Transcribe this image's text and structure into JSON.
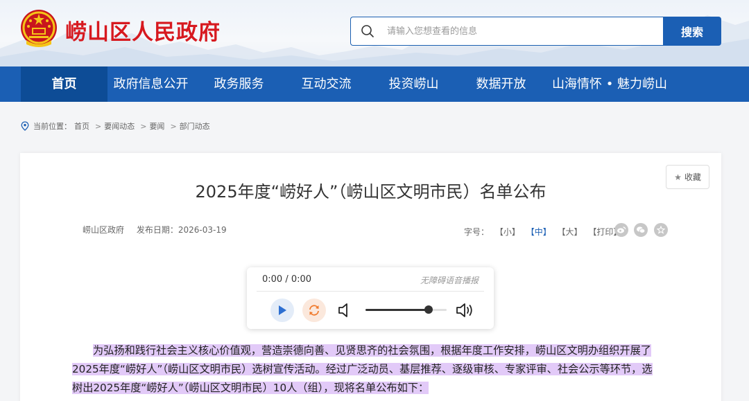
{
  "header": {
    "site_title": "崂山区人民政府",
    "search_placeholder": "请输入您想查看的信息",
    "search_button": "搜索"
  },
  "nav": {
    "items": [
      {
        "label": "首页",
        "active": true
      },
      {
        "label": "政府信息公开",
        "active": false
      },
      {
        "label": "政务服务",
        "active": false
      },
      {
        "label": "互动交流",
        "active": false
      },
      {
        "label": "投资崂山",
        "active": false
      },
      {
        "label": "数据开放",
        "active": false
      },
      {
        "label": "山海情怀 • 魅力崂山",
        "active": false
      }
    ]
  },
  "breadcrumb": {
    "prefix": "当前位置：",
    "items": [
      "首页",
      "要闻动态",
      "要闻",
      "部门动态"
    ]
  },
  "article": {
    "favorite_label": "收藏",
    "title": "2025年度“崂好人”（崂山区文明市民）名单公布",
    "source": "崂山区政府",
    "publish_date": "发布日期：2026-03-19",
    "font_size_label": "字号：",
    "font_small": "【小】",
    "font_medium": "【中】",
    "font_large": "【大】",
    "print": "【打印】",
    "share_icons": [
      "weibo-icon",
      "wechat-icon",
      "star-icon"
    ],
    "body_lines": [
      "为弘扬和践行社会主义核心价值观，营造崇德向善、见贤思齐的社会氛围，根据年度工作安排，崂山区文明办组织开展了",
      "2025年度“崂好人”（崂山区文明市民）选树宣传活动。经过广泛动员、基层推荐、逐级审核、专家评审、社会公示等环节，选",
      "树出2025年度“崂好人”（崂山区文明市民）10人（组），现将名单公布如下："
    ]
  },
  "player": {
    "time": "0:00 / 0:00",
    "tts_label": "无障碍语音播报",
    "volume": 0.78
  },
  "colors": {
    "brand_blue": "#1b5fb4",
    "nav_active": "#0d4c96",
    "title_red": "#d7191f",
    "highlight": "#e2caf8"
  }
}
